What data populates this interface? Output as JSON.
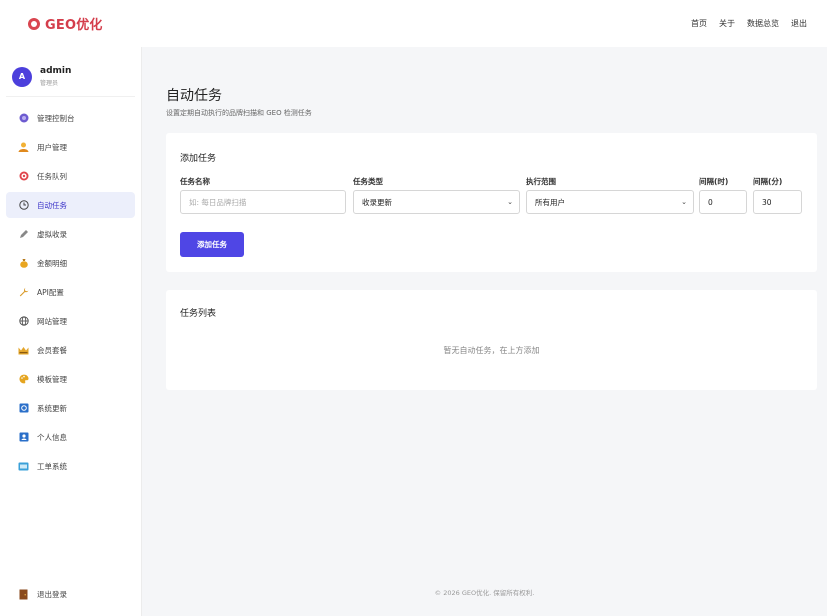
{
  "brand": {
    "name": "GEO优化",
    "color": "#d43d4b"
  },
  "topnav": [
    "首页",
    "关于",
    "数据总览",
    "退出"
  ],
  "user": {
    "avatar_letter": "A",
    "name": "admin",
    "role": "管理员"
  },
  "sidebar": {
    "items": [
      {
        "label": "管理控制台",
        "icon": "dashboard-icon",
        "active": false
      },
      {
        "label": "用户管理",
        "icon": "users-icon",
        "active": false
      },
      {
        "label": "任务队列",
        "icon": "queue-icon",
        "active": false
      },
      {
        "label": "自动任务",
        "icon": "clock-icon",
        "active": true
      },
      {
        "label": "虚拟收录",
        "icon": "pen-icon",
        "active": false
      },
      {
        "label": "金额明细",
        "icon": "money-bag-icon",
        "active": false
      },
      {
        "label": "API配置",
        "icon": "wrench-icon",
        "active": false
      },
      {
        "label": "网站管理",
        "icon": "globe-icon",
        "active": false
      },
      {
        "label": "会员套餐",
        "icon": "crown-icon",
        "active": false
      },
      {
        "label": "模板管理",
        "icon": "palette-icon",
        "active": false
      },
      {
        "label": "系统更新",
        "icon": "update-icon",
        "active": false
      },
      {
        "label": "个人信息",
        "icon": "person-icon",
        "active": false
      },
      {
        "label": "工单系统",
        "icon": "ticket-icon",
        "active": false
      }
    ],
    "logout_label": "退出登录"
  },
  "page": {
    "title": "自动任务",
    "subtitle": "设置定期自动执行的品牌扫描和 GEO 检测任务"
  },
  "add_card": {
    "title": "添加任务",
    "fields": {
      "name_label": "任务名称",
      "name_placeholder": "如: 每日品牌扫描",
      "type_label": "任务类型",
      "type_value": "收录更新",
      "scope_label": "执行范围",
      "scope_value": "所有用户",
      "hours_label": "间隔(时)",
      "hours_value": "0",
      "minutes_label": "间隔(分)",
      "minutes_value": "30"
    },
    "submit_label": "添加任务",
    "accent": "#4f46e5"
  },
  "list_card": {
    "title": "任务列表",
    "empty_text": "暂无自动任务，在上方添加"
  },
  "footer": "© 2026 GEO优化. 保留所有权利."
}
